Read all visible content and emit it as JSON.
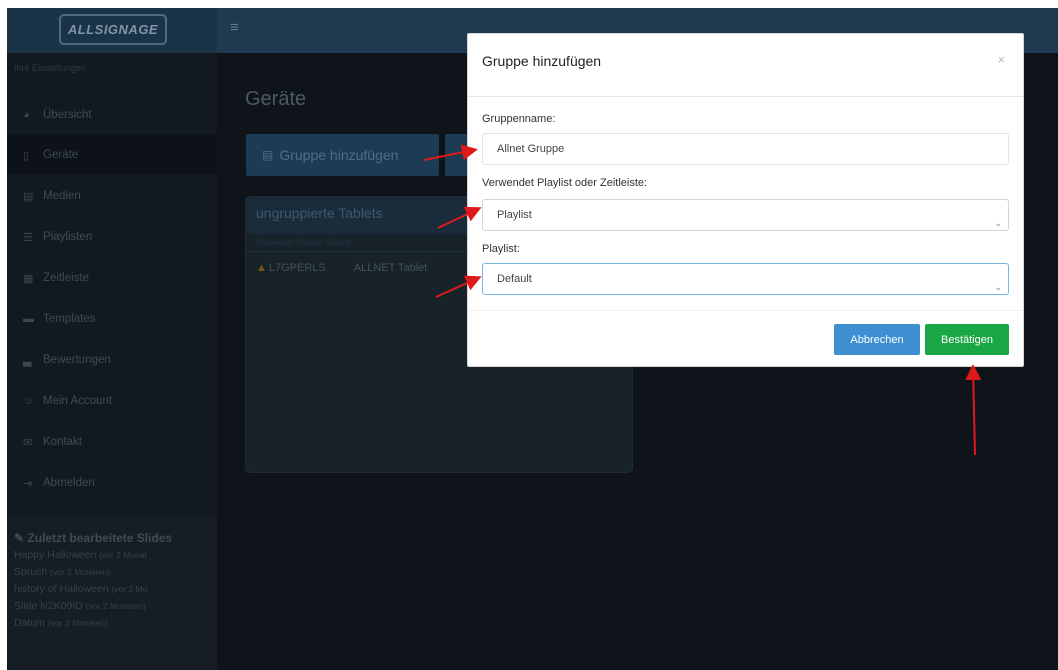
{
  "brand": {
    "logo_text": "ALLSIGNAGE"
  },
  "topbar": {
    "menu_icon": "≡"
  },
  "sidebar": {
    "section_label": "Ihre Einstellungen",
    "items": [
      {
        "label": "Übersicht",
        "icon": "dashboard-icon",
        "glyph": "◕"
      },
      {
        "label": "Geräte",
        "icon": "tablet-icon",
        "glyph": "▯"
      },
      {
        "label": "Medien",
        "icon": "image-icon",
        "glyph": "▤"
      },
      {
        "label": "Playlisten",
        "icon": "list-icon",
        "glyph": "☰"
      },
      {
        "label": "Zeitleiste",
        "icon": "calendar-icon",
        "glyph": "▦"
      },
      {
        "label": "Templates",
        "icon": "folder-icon",
        "glyph": "▬"
      },
      {
        "label": "Bewertungen",
        "icon": "chart-icon",
        "glyph": "▃"
      },
      {
        "label": "Mein Account",
        "icon": "user-icon",
        "glyph": "☺"
      },
      {
        "label": "Kontakt",
        "icon": "envelope-icon",
        "glyph": "✉"
      },
      {
        "label": "Abmelden",
        "icon": "logout-icon",
        "glyph": "⇥"
      }
    ],
    "recent": {
      "title": "Zuletzt bearbeitete Slides",
      "title_icon": "✎",
      "items": [
        {
          "name": "Happy Halloween",
          "ago": "(vor 2 Monat"
        },
        {
          "name": "Spruch",
          "ago": "(vor 2 Monaten)"
        },
        {
          "name": "history of Halloween",
          "ago": "(vor 2 Mo"
        },
        {
          "name": "Slide lv2K09ID",
          "ago": "(vor 2 Monaten)"
        },
        {
          "name": "Datum",
          "ago": "(vor 2 Monaten)"
        }
      ]
    }
  },
  "main": {
    "page_title": "Geräte",
    "add_group_button": "Gruppe hinzufügen",
    "add_group_icon": "▤",
    "panel": {
      "title": "ungruppierte Tablets",
      "subtitle": "Verwendet Playlist: Default",
      "row": {
        "id": "L7GPERLS",
        "name": "ALLNET Tablet",
        "warning_icon": "▲"
      }
    }
  },
  "modal": {
    "title": "Gruppe hinzufügen",
    "close": "×",
    "group_name_label": "Gruppenname:",
    "group_name_value": "Allnet Gruppe",
    "mode_label": "Verwendet Playlist oder Zeitleiste:",
    "mode_value": "Playlist",
    "playlist_label": "Playlist:",
    "playlist_value": "Default",
    "cancel_label": "Abbrechen",
    "confirm_label": "Bestätigen"
  },
  "colors": {
    "annotation_arrow": "#e0191b",
    "confirm": "#19a745",
    "cancel": "#3d8fd1",
    "navbar": "#1f3a50"
  }
}
